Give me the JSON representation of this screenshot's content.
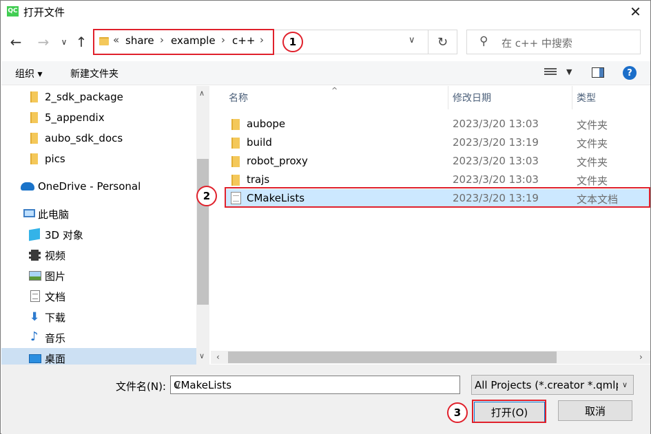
{
  "window": {
    "title": "打开文件",
    "app_icon_text": "QC"
  },
  "address": {
    "crumbs": [
      "share",
      "example",
      "c++"
    ],
    "overflow": "«"
  },
  "search": {
    "placeholder": "在 c++ 中搜索"
  },
  "toolbar": {
    "organize": "组织 ▾",
    "new_folder": "新建文件夹"
  },
  "nav": {
    "items": [
      {
        "label": "2_sdk_package",
        "icon": "folder-icon"
      },
      {
        "label": "5_appendix",
        "icon": "folder-icon"
      },
      {
        "label": "aubo_sdk_docs",
        "icon": "folder-icon"
      },
      {
        "label": "pics",
        "icon": "folder-icon"
      },
      {
        "label": "OneDrive - Personal",
        "icon": "cloud-icon"
      },
      {
        "label": "此电脑",
        "icon": "computer-icon"
      },
      {
        "label": "3D 对象",
        "icon": "cube-icon"
      },
      {
        "label": "视频",
        "icon": "video-icon"
      },
      {
        "label": "图片",
        "icon": "picture-icon"
      },
      {
        "label": "文档",
        "icon": "document-icon"
      },
      {
        "label": "下载",
        "icon": "download-icon"
      },
      {
        "label": "音乐",
        "icon": "music-icon"
      },
      {
        "label": "桌面",
        "icon": "desktop-icon"
      }
    ]
  },
  "files": {
    "columns": [
      "名称",
      "修改日期",
      "类型"
    ],
    "rows": [
      {
        "name": "aubope",
        "date": "2023/3/20 13:03",
        "type": "文件夹",
        "kind": "folder"
      },
      {
        "name": "build",
        "date": "2023/3/20 13:19",
        "type": "文件夹",
        "kind": "folder"
      },
      {
        "name": "robot_proxy",
        "date": "2023/3/20 13:03",
        "type": "文件夹",
        "kind": "folder"
      },
      {
        "name": "trajs",
        "date": "2023/3/20 13:03",
        "type": "文件夹",
        "kind": "folder"
      },
      {
        "name": "CMakeLists",
        "date": "2023/3/20 13:19",
        "type": "文本文档",
        "kind": "text"
      }
    ]
  },
  "bottom": {
    "filename_label": "文件名(N):",
    "filename_value": "CMakeLists",
    "filetype_value": "All Projects (*.creator *.qmlp",
    "open_label": "打开(O)",
    "cancel_label": "取消"
  },
  "callouts": [
    "1",
    "2",
    "3"
  ],
  "colors": {
    "callout_red": "#e0202b",
    "selection_blue": "#cce8ff",
    "folder_yellow": "#f4c85a"
  }
}
